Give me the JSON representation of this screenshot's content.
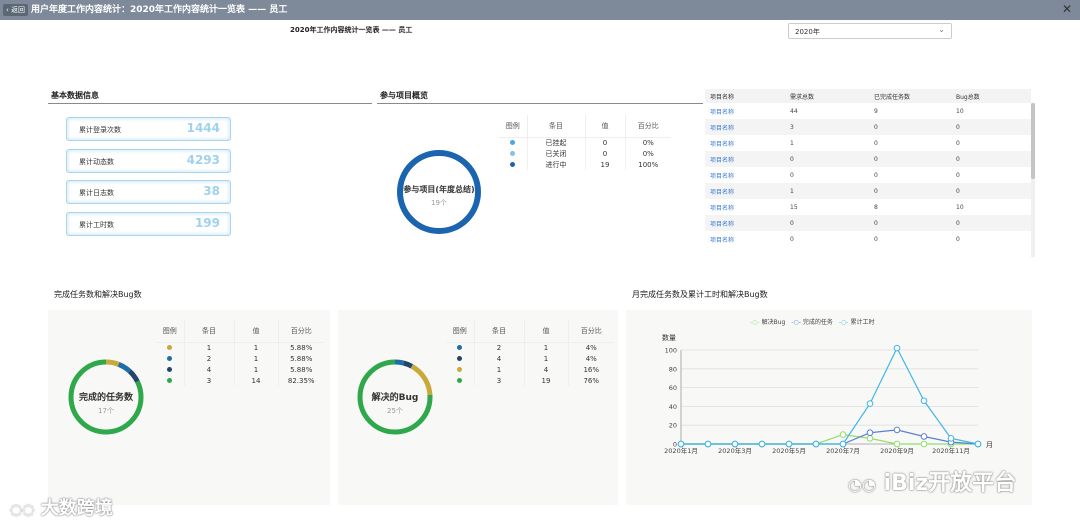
{
  "window": {
    "back_label": "返回",
    "title": "用户年度工作内容统计：2020年工作内容统计一览表 —— 员工",
    "close_icon": "close-icon"
  },
  "report": {
    "title": "2020年工作内容统计一览表 —— 员工",
    "year_select": {
      "value": "2020年"
    }
  },
  "basic_info": {
    "heading": "基本数据信息",
    "stats": [
      {
        "label": "累计登录次数",
        "value": "1444"
      },
      {
        "label": "累计动态数",
        "value": "4293"
      },
      {
        "label": "累计日志数",
        "value": "38"
      },
      {
        "label": "累计工时数",
        "value": "199"
      }
    ]
  },
  "projects_overview": {
    "heading": "参与项目概览",
    "donut_title": "参与项目(年度总结)",
    "donut_sub": "19个",
    "columns": [
      "图例",
      "条目",
      "值",
      "百分比"
    ],
    "rows": [
      {
        "color": "#4aa8e0",
        "item": "已挂起",
        "value": "0",
        "pct": "0%"
      },
      {
        "color": "#7ec4ec",
        "item": "已关闭",
        "value": "0",
        "pct": "0%"
      },
      {
        "color": "#1b64b0",
        "item": "进行中",
        "value": "19",
        "pct": "100%"
      }
    ]
  },
  "project_table": {
    "columns": [
      "项目名称",
      "需求总数",
      "已完成任务数",
      "Bug总数"
    ],
    "rows": [
      [
        "项目名称",
        "44",
        "9",
        "10"
      ],
      [
        "项目名称",
        "3",
        "0",
        "0"
      ],
      [
        "项目名称",
        "1",
        "0",
        "0"
      ],
      [
        "项目名称",
        "0",
        "0",
        "0"
      ],
      [
        "项目名称",
        "0",
        "0",
        "0"
      ],
      [
        "项目名称",
        "1",
        "0",
        "0"
      ],
      [
        "项目名称",
        "15",
        "8",
        "10"
      ],
      [
        "项目名称",
        "0",
        "0",
        "0"
      ],
      [
        "项目名称",
        "0",
        "0",
        "0"
      ]
    ]
  },
  "tasks_bugs": {
    "heading": "完成任务数和解决Bug数",
    "tasks": {
      "donut_title": "完成的任务数",
      "donut_sub": "17个",
      "columns": [
        "图例",
        "条目",
        "值",
        "百分比"
      ],
      "rows": [
        {
          "color": "#c9a93a",
          "item": "1",
          "value": "1",
          "pct": "5.88%"
        },
        {
          "color": "#1e6fa8",
          "item": "2",
          "value": "1",
          "pct": "5.88%"
        },
        {
          "color": "#23456b",
          "item": "4",
          "value": "1",
          "pct": "5.88%"
        },
        {
          "color": "#2ea84a",
          "item": "3",
          "value": "14",
          "pct": "82.35%"
        }
      ]
    },
    "bugs": {
      "donut_title": "解决的Bug",
      "donut_sub": "25个",
      "columns": [
        "图例",
        "条目",
        "值",
        "百分比"
      ],
      "rows": [
        {
          "color": "#1e6fa8",
          "item": "2",
          "value": "1",
          "pct": "4%"
        },
        {
          "color": "#23456b",
          "item": "4",
          "value": "1",
          "pct": "4%"
        },
        {
          "color": "#c9a93a",
          "item": "1",
          "value": "4",
          "pct": "16%"
        },
        {
          "color": "#2ea84a",
          "item": "3",
          "value": "19",
          "pct": "76%"
        }
      ]
    }
  },
  "monthly": {
    "heading": "月完成任务数及累计工时和解决Bug数"
  },
  "chart_data": {
    "type": "line",
    "ylabel": "数量",
    "xlabel": "月",
    "ylim": [
      0,
      100
    ],
    "yticks": [
      0,
      20,
      40,
      60,
      80,
      100
    ],
    "x": [
      "2020年1月",
      "2020年2月",
      "2020年3月",
      "2020年4月",
      "2020年5月",
      "2020年6月",
      "2020年7月",
      "2020年8月",
      "2020年9月",
      "2020年10月",
      "2020年11月",
      "2020年12月"
    ],
    "xtick_labels": [
      "2020年1月",
      "2020年3月",
      "2020年5月",
      "2020年7月",
      "2020年9月",
      "2020年11月"
    ],
    "legend_position": "top",
    "series": [
      {
        "name": "解决Bug",
        "color": "#90e06a",
        "values": [
          0,
          0,
          0,
          0,
          0,
          0,
          10,
          6,
          0,
          0,
          0,
          0
        ]
      },
      {
        "name": "完成的任务",
        "color": "#5b7fd6",
        "values": [
          0,
          0,
          0,
          0,
          0,
          0,
          0,
          12,
          15,
          8,
          2,
          0
        ]
      },
      {
        "name": "累计工时",
        "color": "#3fb7e8",
        "values": [
          0,
          0,
          0,
          0,
          0,
          0,
          0,
          43,
          102,
          46,
          6,
          0
        ]
      }
    ]
  },
  "watermarks": {
    "left": "大数跨境",
    "right": "iBiz开放平台"
  }
}
